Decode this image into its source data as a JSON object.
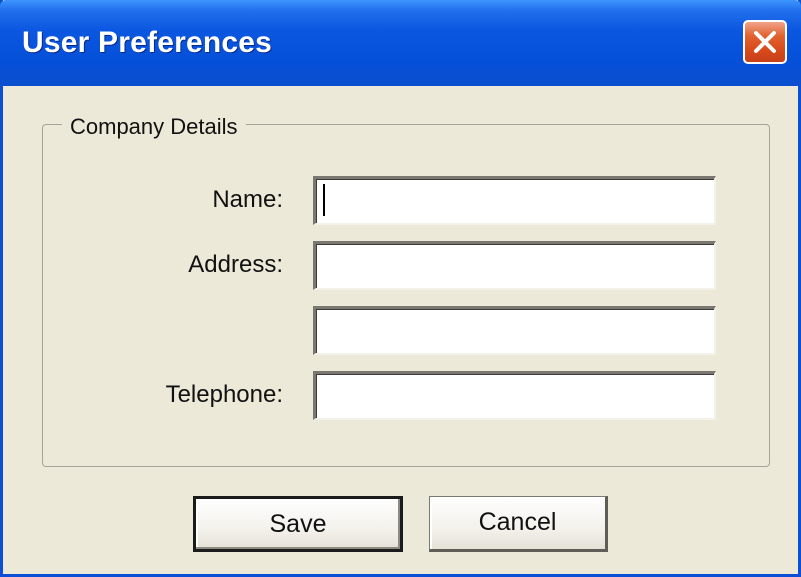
{
  "window": {
    "title": "User Preferences",
    "close_icon": "close-x-icon"
  },
  "group": {
    "legend": "Company Details"
  },
  "fields": {
    "name_label": "Name:",
    "name_value": "",
    "address_label": "Address:",
    "address_line1_value": "",
    "address_line2_value": "",
    "telephone_label": "Telephone:",
    "telephone_value": ""
  },
  "buttons": {
    "save_label": "Save",
    "cancel_label": "Cancel"
  },
  "colors": {
    "titlebar": "#0550d9",
    "close_button": "#d84a1a",
    "dialog_background": "#ece9d8"
  }
}
